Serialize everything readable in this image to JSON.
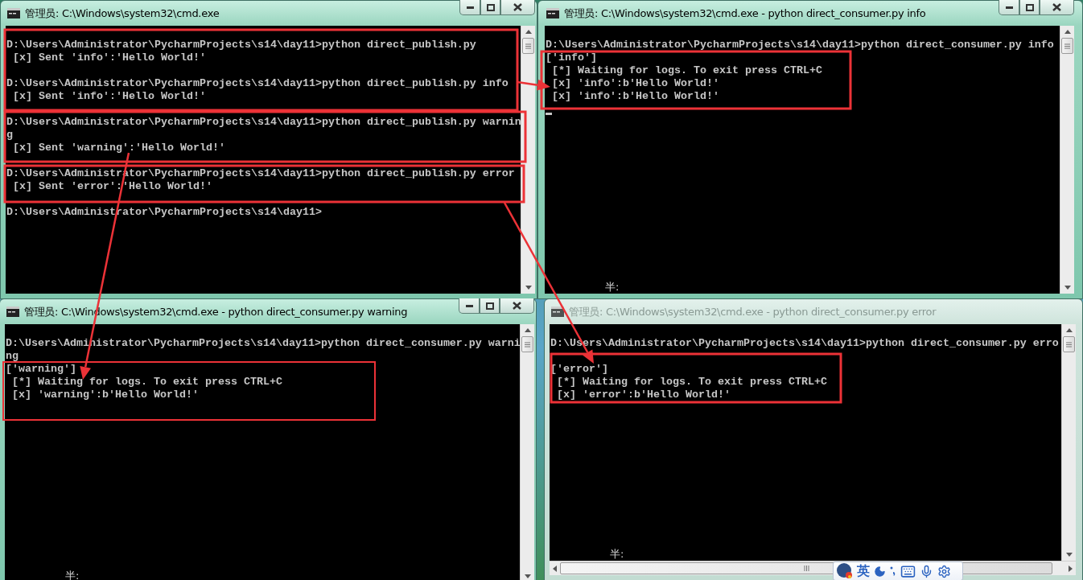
{
  "windows": [
    {
      "title": "管理员: C:\\Windows\\system32\\cmd.exe",
      "active": true,
      "cursor": false,
      "blocks": [
        [
          "D:\\Users\\Administrator\\PycharmProjects\\s14\\day11>python direct_publish.py",
          " [x] Sent 'info':'Hello World!'"
        ],
        [
          "D:\\Users\\Administrator\\PycharmProjects\\s14\\day11>python direct_publish.py info",
          " [x] Sent 'info':'Hello World!'"
        ],
        [
          "D:\\Users\\Administrator\\PycharmProjects\\s14\\day11>python direct_publish.py warnin",
          "g",
          " [x] Sent 'warning':'Hello World!'"
        ],
        [
          "D:\\Users\\Administrator\\PycharmProjects\\s14\\day11>python direct_publish.py error",
          " [x] Sent 'error':'Hello World!'"
        ],
        [
          "D:\\Users\\Administrator\\PycharmProjects\\s14\\day11>"
        ]
      ]
    },
    {
      "title": "管理员: C:\\Windows\\system32\\cmd.exe - python  direct_consumer.py info",
      "active": true,
      "cursor": true,
      "ime_status": "半:",
      "blocks": [
        [
          "D:\\Users\\Administrator\\PycharmProjects\\s14\\day11>python direct_consumer.py info",
          "['info']",
          " [*] Waiting for logs. To exit press CTRL+C",
          " [x] 'info':b'Hello World!'",
          " [x] 'info':b'Hello World!'"
        ]
      ]
    },
    {
      "title": "管理员: C:\\Windows\\system32\\cmd.exe - python  direct_consumer.py warning",
      "active": true,
      "cursor": false,
      "ime_status": "半:",
      "blocks": [
        [
          "D:\\Users\\Administrator\\PycharmProjects\\s14\\day11>python direct_consumer.py warni",
          "ng",
          "['warning']",
          " [*] Waiting for logs. To exit press CTRL+C",
          " [x] 'warning':b'Hello World!'"
        ]
      ]
    },
    {
      "title": "管理员: C:\\Windows\\system32\\cmd.exe - python  direct_consumer.py error",
      "active": false,
      "cursor": false,
      "ime_status": "半:",
      "blocks": [
        [
          "D:\\Users\\Administrator\\PycharmProjects\\s14\\day11>python direct_consumer.py erro"
        ],
        [
          "['error']",
          " [*] Waiting for logs. To exit press CTRL+C",
          " [x] 'error':b'Hello World!'"
        ]
      ]
    }
  ],
  "ime_toolbar": {
    "mode": "英"
  }
}
